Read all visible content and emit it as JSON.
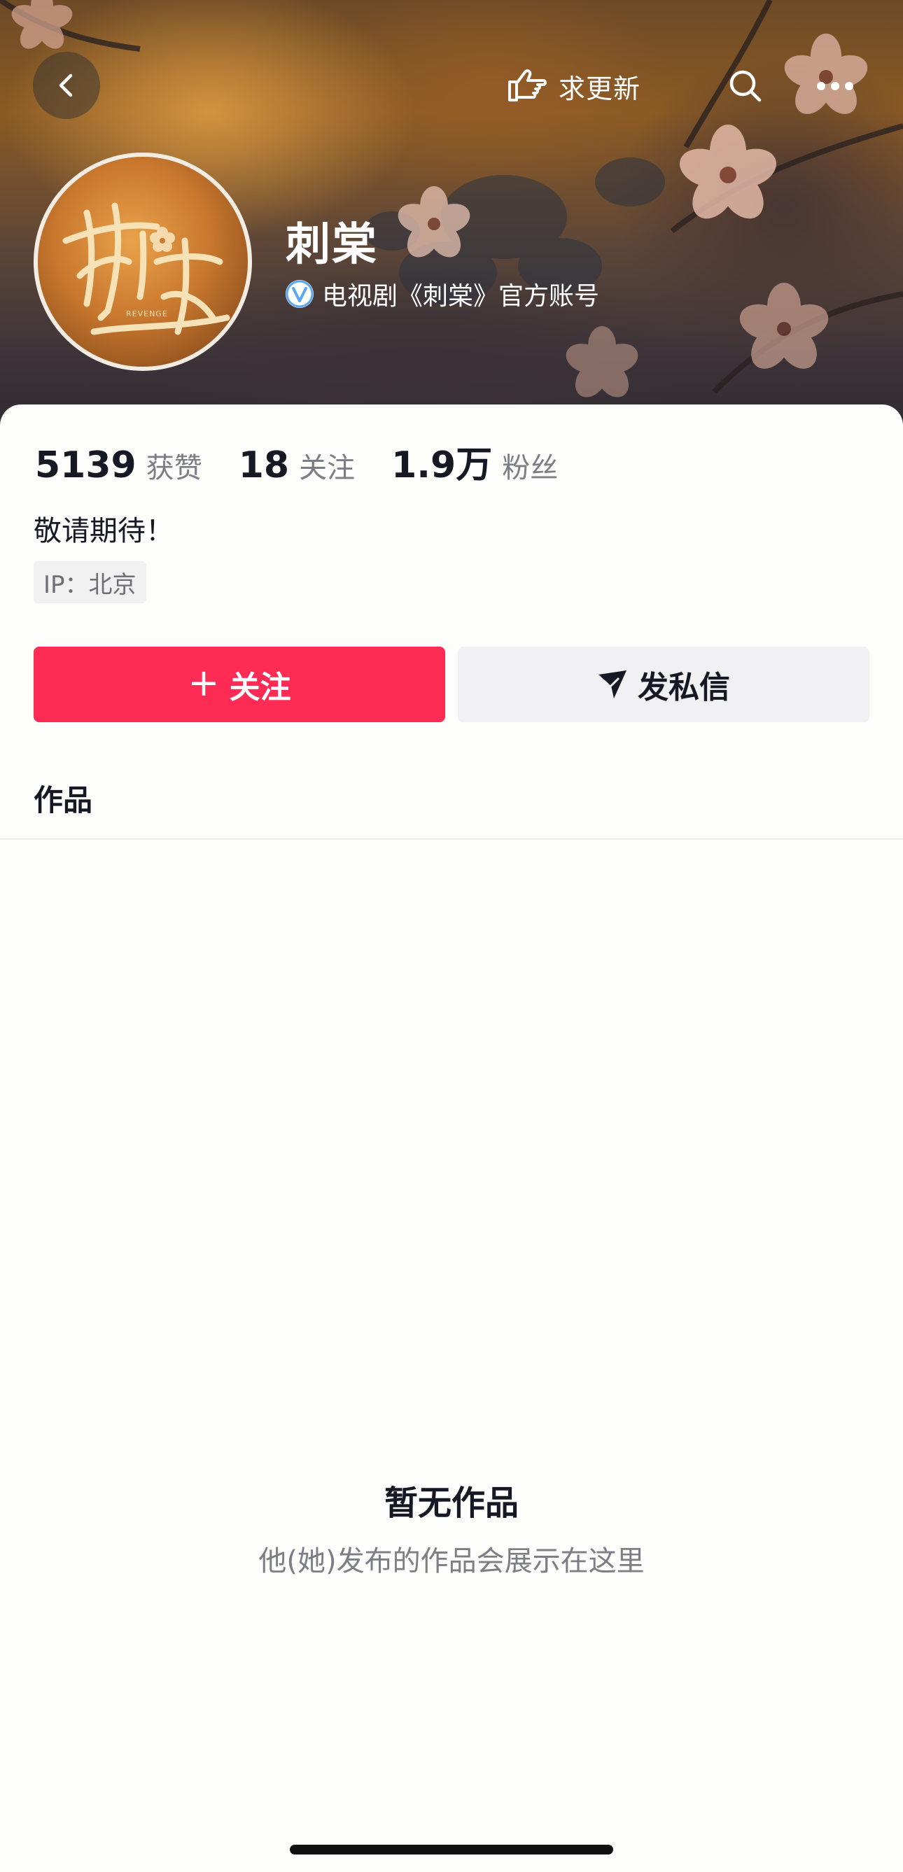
{
  "header": {
    "update_label": "求更新",
    "name": "刺棠",
    "verification": "电视剧《刺棠》官方账号",
    "avatar_text": "REVENGE"
  },
  "stats": [
    {
      "value": "5139",
      "label": "获赞"
    },
    {
      "value": "18",
      "label": "关注"
    },
    {
      "value": "1.9万",
      "label": "粉丝"
    }
  ],
  "bio": "敬请期待！",
  "ip_location": "IP：北京",
  "actions": {
    "follow_label": "关注",
    "message_label": "发私信"
  },
  "tabs": {
    "works_label": "作品"
  },
  "empty_state": {
    "title": "暂无作品",
    "subtitle": "他(她)发布的作品会展示在这里"
  },
  "colors": {
    "accent": "#fe2c55",
    "text_primary": "#161823",
    "text_secondary": "#7d7e85",
    "verify_blue": "#5aa9f0"
  },
  "icons": [
    "back-icon",
    "pointing-hand-icon",
    "search-icon",
    "more-icon",
    "verified-icon",
    "plus-icon",
    "send-icon"
  ]
}
